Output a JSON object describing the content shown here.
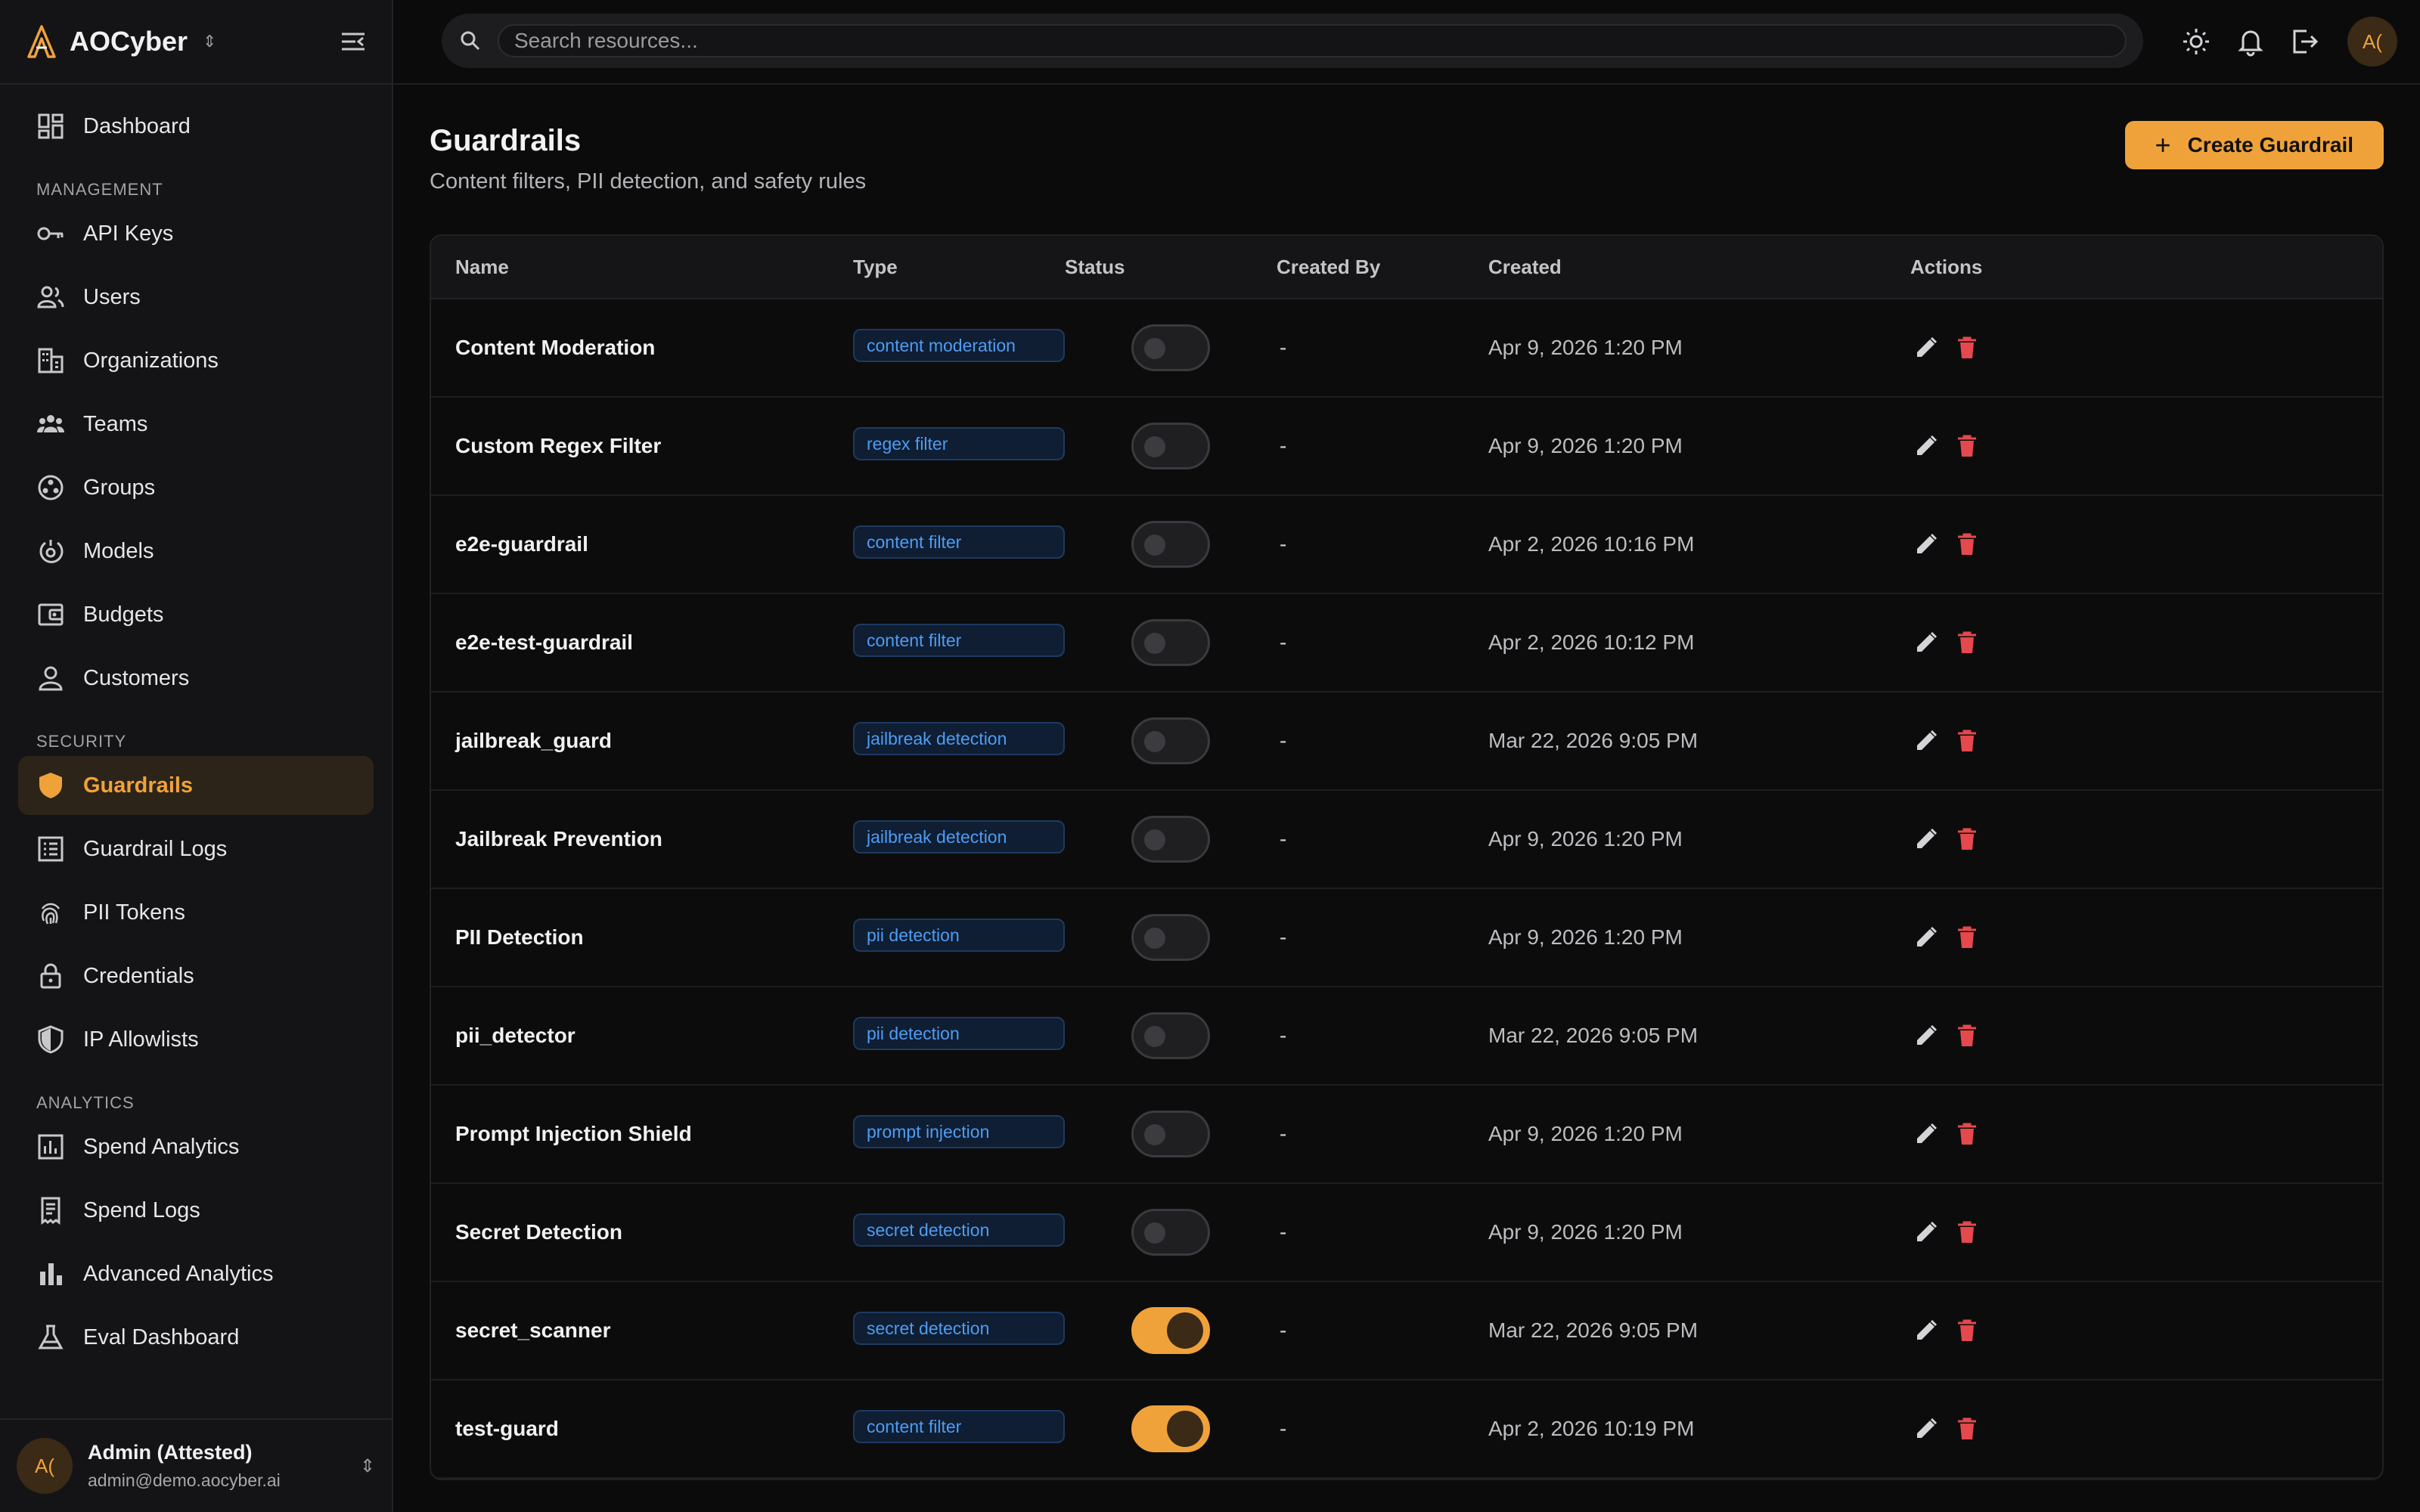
{
  "brand": {
    "name": "AOCyber"
  },
  "search": {
    "placeholder": "Search resources..."
  },
  "top_avatar": "A(",
  "sidebar": {
    "top_items": [
      {
        "label": "Dashboard",
        "icon": "dashboard-icon"
      }
    ],
    "sections": [
      {
        "label": "MANAGEMENT",
        "items": [
          {
            "label": "API Keys",
            "icon": "key-icon"
          },
          {
            "label": "Users",
            "icon": "users-icon"
          },
          {
            "label": "Organizations",
            "icon": "building-icon"
          },
          {
            "label": "Teams",
            "icon": "teams-icon"
          },
          {
            "label": "Groups",
            "icon": "groups-icon"
          },
          {
            "label": "Models",
            "icon": "models-icon"
          },
          {
            "label": "Budgets",
            "icon": "wallet-icon"
          },
          {
            "label": "Customers",
            "icon": "person-icon"
          }
        ]
      },
      {
        "label": "SECURITY",
        "items": [
          {
            "label": "Guardrails",
            "icon": "shield-icon",
            "active": true
          },
          {
            "label": "Guardrail Logs",
            "icon": "log-list-icon"
          },
          {
            "label": "PII Tokens",
            "icon": "fingerprint-icon"
          },
          {
            "label": "Credentials",
            "icon": "lock-icon"
          },
          {
            "label": "IP Allowlists",
            "icon": "shield-check-icon"
          }
        ]
      },
      {
        "label": "ANALYTICS",
        "items": [
          {
            "label": "Spend Analytics",
            "icon": "chart-box-icon"
          },
          {
            "label": "Spend Logs",
            "icon": "receipt-icon"
          },
          {
            "label": "Advanced Analytics",
            "icon": "bar-chart-icon"
          },
          {
            "label": "Eval Dashboard",
            "icon": "flask-icon"
          }
        ]
      }
    ],
    "user": {
      "avatar": "A(",
      "name": "Admin (Attested)",
      "email": "admin@demo.aocyber.ai"
    }
  },
  "page": {
    "title": "Guardrails",
    "subtitle": "Content filters, PII detection, and safety rules",
    "create_label": "Create Guardrail"
  },
  "table": {
    "headers": {
      "name": "Name",
      "type": "Type",
      "status": "Status",
      "created_by": "Created By",
      "created": "Created",
      "actions": "Actions"
    },
    "rows": [
      {
        "name": "Content Moderation",
        "type": "content moderation",
        "enabled": false,
        "created_by": "-",
        "created": "Apr 9, 2026 1:20 PM"
      },
      {
        "name": "Custom Regex Filter",
        "type": "regex filter",
        "enabled": false,
        "created_by": "-",
        "created": "Apr 9, 2026 1:20 PM"
      },
      {
        "name": "e2e-guardrail",
        "type": "content filter",
        "enabled": false,
        "created_by": "-",
        "created": "Apr 2, 2026 10:16 PM"
      },
      {
        "name": "e2e-test-guardrail",
        "type": "content filter",
        "enabled": false,
        "created_by": "-",
        "created": "Apr 2, 2026 10:12 PM"
      },
      {
        "name": "jailbreak_guard",
        "type": "jailbreak detection",
        "enabled": false,
        "created_by": "-",
        "created": "Mar 22, 2026 9:05 PM"
      },
      {
        "name": "Jailbreak Prevention",
        "type": "jailbreak detection",
        "enabled": false,
        "created_by": "-",
        "created": "Apr 9, 2026 1:20 PM"
      },
      {
        "name": "PII Detection",
        "type": "pii detection",
        "enabled": false,
        "created_by": "-",
        "created": "Apr 9, 2026 1:20 PM"
      },
      {
        "name": "pii_detector",
        "type": "pii detection",
        "enabled": false,
        "created_by": "-",
        "created": "Mar 22, 2026 9:05 PM"
      },
      {
        "name": "Prompt Injection Shield",
        "type": "prompt injection",
        "enabled": false,
        "created_by": "-",
        "created": "Apr 9, 2026 1:20 PM"
      },
      {
        "name": "Secret Detection",
        "type": "secret detection",
        "enabled": false,
        "created_by": "-",
        "created": "Apr 9, 2026 1:20 PM"
      },
      {
        "name": "secret_scanner",
        "type": "secret detection",
        "enabled": true,
        "created_by": "-",
        "created": "Mar 22, 2026 9:05 PM"
      },
      {
        "name": "test-guard",
        "type": "content filter",
        "enabled": true,
        "created_by": "-",
        "created": "Apr 2, 2026 10:19 PM"
      }
    ]
  },
  "colors": {
    "accent": "#f0a23a",
    "badge_text": "#4e9cf3",
    "delete": "#e5484d",
    "background": "#0b0b0c",
    "sidebar": "#141416"
  }
}
